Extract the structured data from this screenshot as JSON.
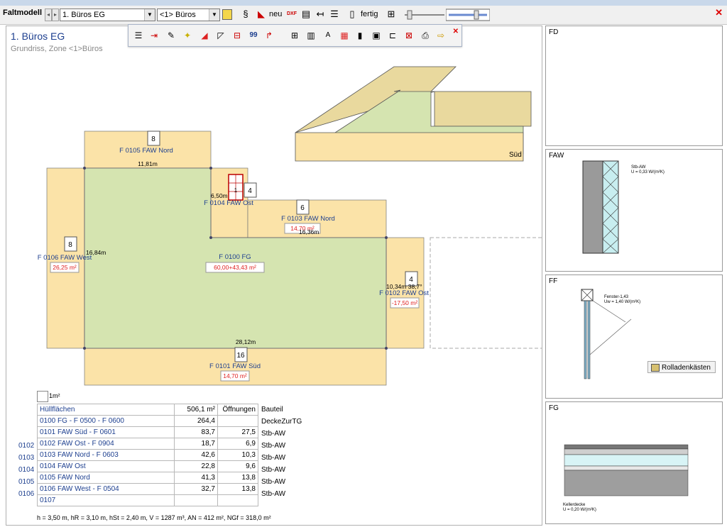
{
  "app": {
    "title": "Faltmodell"
  },
  "toolbar": {
    "floor_select": "1. Büros EG",
    "zone_select": "<1> Büros",
    "new_label": "neu",
    "dxf_label": "DXF",
    "done_label": "fertig"
  },
  "page": {
    "title": "1. Büros EG",
    "subtitle": "Grundriss, Zone <1>Büros"
  },
  "plan": {
    "top_wall": {
      "num": "8",
      "label": "F 0105 FAW Nord",
      "dim": "11,81m"
    },
    "east_small": {
      "num": "4",
      "label": "F 0104 FAW Ost",
      "dim": "6,50m",
      "window": "1"
    },
    "north_right": {
      "num": "6",
      "label": "F 0103 FAW Nord",
      "area": "14,70 m²",
      "dim": "16,36m"
    },
    "west": {
      "num": "8",
      "label": "F 0106 FAW West",
      "area": "26,25 m²",
      "dim": "16,84m"
    },
    "floor": {
      "label": "F 0100 FG",
      "area": "60,00+43,43 m²"
    },
    "east": {
      "num": "4",
      "label": "F 0102 FAW Ost",
      "area": "-17,50 m²",
      "dim": "10,34m 38,7°"
    },
    "south": {
      "num": "16",
      "label": "F 0101 FAW Süd",
      "area": "14,70 m²",
      "dim": "28,12m"
    },
    "view3d_label": "Süd"
  },
  "legend": {
    "unit": "1m²"
  },
  "table": {
    "header": {
      "name": "Hüllflächen",
      "area": "506,1 m²",
      "openings": "Öffnungen",
      "part": "Bauteil"
    },
    "rows": [
      {
        "id": "",
        "name": "0100 FG  - F 0500 - F 0600",
        "area": "264,4",
        "open": "",
        "part": "DeckeZurTG"
      },
      {
        "id": "",
        "name": "0101 FAW Süd  - F 0601",
        "area": "83,7",
        "open": "27,5",
        "part": "Stb-AW"
      },
      {
        "id": "0102",
        "name": "0102 FAW Ost  - F 0904",
        "area": "18,7",
        "open": "6,9",
        "part": "Stb-AW"
      },
      {
        "id": "0103",
        "name": "0103 FAW Nord  - F 0603",
        "area": "42,6",
        "open": "10,3",
        "part": "Stb-AW"
      },
      {
        "id": "0104",
        "name": "0104 FAW Ost",
        "area": "22,8",
        "open": "9,6",
        "part": "Stb-AW"
      },
      {
        "id": "0105",
        "name": "0105 FAW Nord",
        "area": "41,3",
        "open": "13,8",
        "part": "Stb-AW"
      },
      {
        "id": "0106",
        "name": "0106 FAW West  - F 0504",
        "area": "32,7",
        "open": "13,8",
        "part": "Stb-AW"
      },
      {
        "id": "",
        "name": "0107",
        "area": "",
        "open": "",
        "part": ""
      }
    ],
    "footer": "h = 3,50 m, hR = 3,10 m, hSt = 2,40 m, V = 1287 m³, AN = 412 m², NGf = 318,0 m²"
  },
  "panels": {
    "fd": {
      "label": "FD"
    },
    "faw": {
      "label": "FAW",
      "note1": "Stb-AW",
      "note2": "U = 0,33 W/(m²K)"
    },
    "ff": {
      "label": "FF",
      "note1": "Fenster-1,43",
      "note2": "Uw = 1,40 W/(m²K)",
      "button": "Rolladenkästen"
    },
    "fg": {
      "label": "FG",
      "note1": "Kellerdecke",
      "note2": "U = 0,20 W/(m²K)"
    }
  },
  "colors": {
    "wall": "#fbe3a8",
    "floor": "#d5e4b0",
    "accent": "#1d3f8f",
    "red": "#e02020"
  }
}
